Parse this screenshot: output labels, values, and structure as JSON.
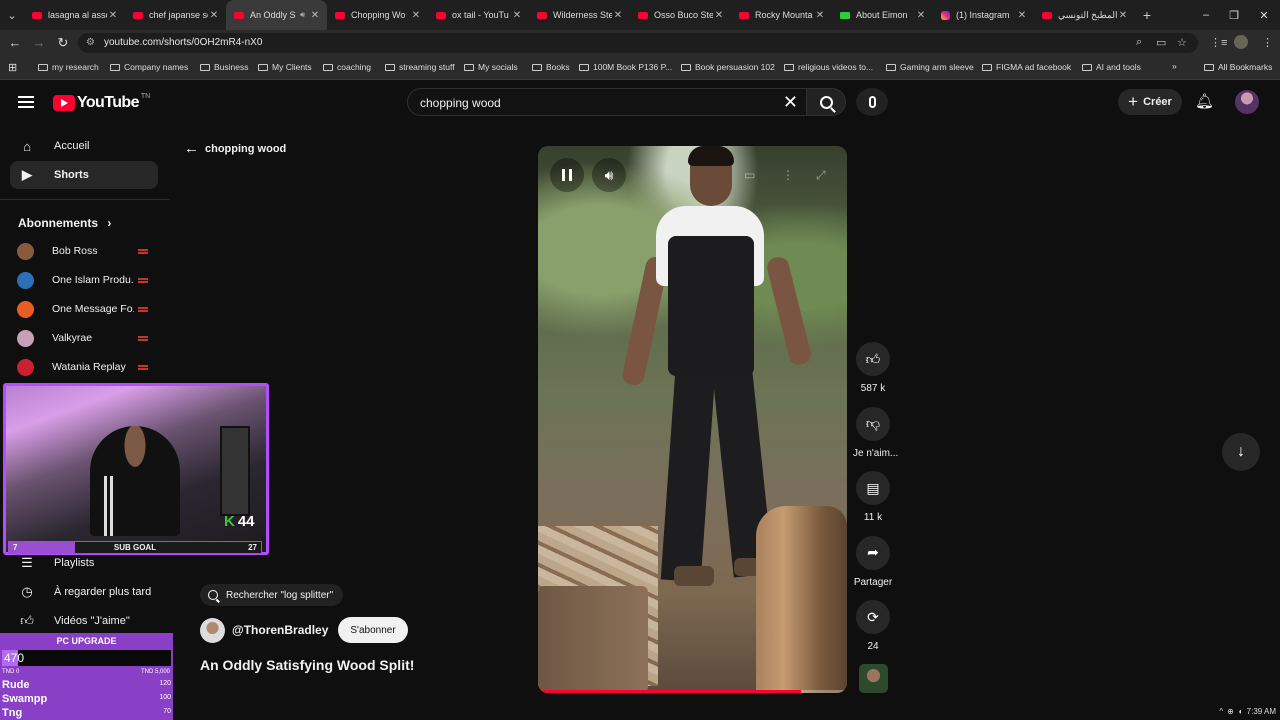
{
  "browser": {
    "tabs": [
      {
        "label": "lasagna al asso",
        "icon": "youtube-icon",
        "active": false
      },
      {
        "label": "chef japanse sc",
        "icon": "youtube-icon",
        "active": false
      },
      {
        "label": "An Oddly S",
        "icon": "youtube-icon",
        "active": true
      },
      {
        "label": "Chopping Wo",
        "icon": "youtube-icon",
        "active": false
      },
      {
        "label": "ox tail - YouTu",
        "icon": "youtube-icon",
        "active": false
      },
      {
        "label": "Wilderness Ste",
        "icon": "youtube-icon",
        "active": false
      },
      {
        "label": "Osso Buco Ste",
        "icon": "youtube-icon",
        "active": false
      },
      {
        "label": "Rocky Mounta",
        "icon": "youtube-icon",
        "active": false
      },
      {
        "label": "About Eimon",
        "icon": "green-k-icon",
        "active": false
      },
      {
        "label": "(1) Instagram",
        "icon": "instagram-icon",
        "active": false
      },
      {
        "label": "المطبخ التونسي",
        "icon": "youtube-icon",
        "active": false
      }
    ],
    "new_tab": "+",
    "window_controls": {
      "minimize": "–",
      "maximize": "❐",
      "close": "✕"
    },
    "url": "youtube.com/shorts/0OH2mR4-nX0",
    "bookmarks": [
      "my research",
      "Company names",
      "Business",
      "My Clients",
      "coaching",
      "streaming stuff",
      "My socials",
      "Books",
      "100M Book P136 P...",
      "Book persuasion 102",
      "religious videos to...",
      "Gaming arm sleeve",
      "FIGMA ad facebook",
      "AI and tools"
    ],
    "all_bookmarks": "All Bookmarks"
  },
  "header": {
    "logo_text": "YouTube",
    "logo_region": "TN",
    "search_query": "chopping wood",
    "create_label": "Créer"
  },
  "sidebar": {
    "items": [
      {
        "label": "Accueil",
        "icon": "home-icon",
        "active": false
      },
      {
        "label": "Shorts",
        "icon": "shorts-icon",
        "active": true
      }
    ],
    "subscriptions_title": "Abonnements",
    "subscriptions": [
      {
        "name": "Bob Ross",
        "color": "#8a5a3c"
      },
      {
        "name": "One Islam Produ...",
        "color": "#2d6fb5"
      },
      {
        "name": "One Message Fo...",
        "color": "#e85d24"
      },
      {
        "name": "Valkyrae",
        "color": "#c7a0b8"
      },
      {
        "name": "Watania Replay",
        "color": "#cc1f2f"
      }
    ],
    "lower_items": [
      {
        "label": "Playlists",
        "icon": "playlist-icon"
      },
      {
        "label": "À regarder plus tard",
        "icon": "clock-icon"
      },
      {
        "label": "Vidéos \"J'aime\"",
        "icon": "thumbs-up-icon"
      }
    ]
  },
  "overlay": {
    "webcam_counter": "44",
    "sub_goal": {
      "label": "SUB GOAL",
      "current": "7",
      "target": "27",
      "progress": 0.26
    },
    "pc_upgrade": {
      "title": "PC UPGRADE",
      "amount": "470",
      "min": "TND 0",
      "max": "TND 5,000",
      "progress": 0.094,
      "donors": [
        {
          "name": "Rude",
          "value": "120"
        },
        {
          "name": "Swampp",
          "value": "100"
        },
        {
          "name": "Tng",
          "value": "70"
        }
      ]
    }
  },
  "main": {
    "back_label": "chopping wood",
    "video_progress": 0.85,
    "actions": [
      {
        "icon": "thumbs-up-icon",
        "label": "587 k"
      },
      {
        "icon": "thumbs-down-icon",
        "label": "Je n'aim..."
      },
      {
        "icon": "comment-icon",
        "label": "11 k"
      },
      {
        "icon": "share-icon",
        "label": "Partager"
      },
      {
        "icon": "remix-icon",
        "label": "24"
      }
    ],
    "suggestion": "Rechercher \"log splitter\"",
    "channel": "@ThorenBradley",
    "subscribe_label": "S'abonner",
    "title": "An Oddly Satisfying Wood Split!"
  },
  "tray": {
    "time": "7:39 AM"
  }
}
